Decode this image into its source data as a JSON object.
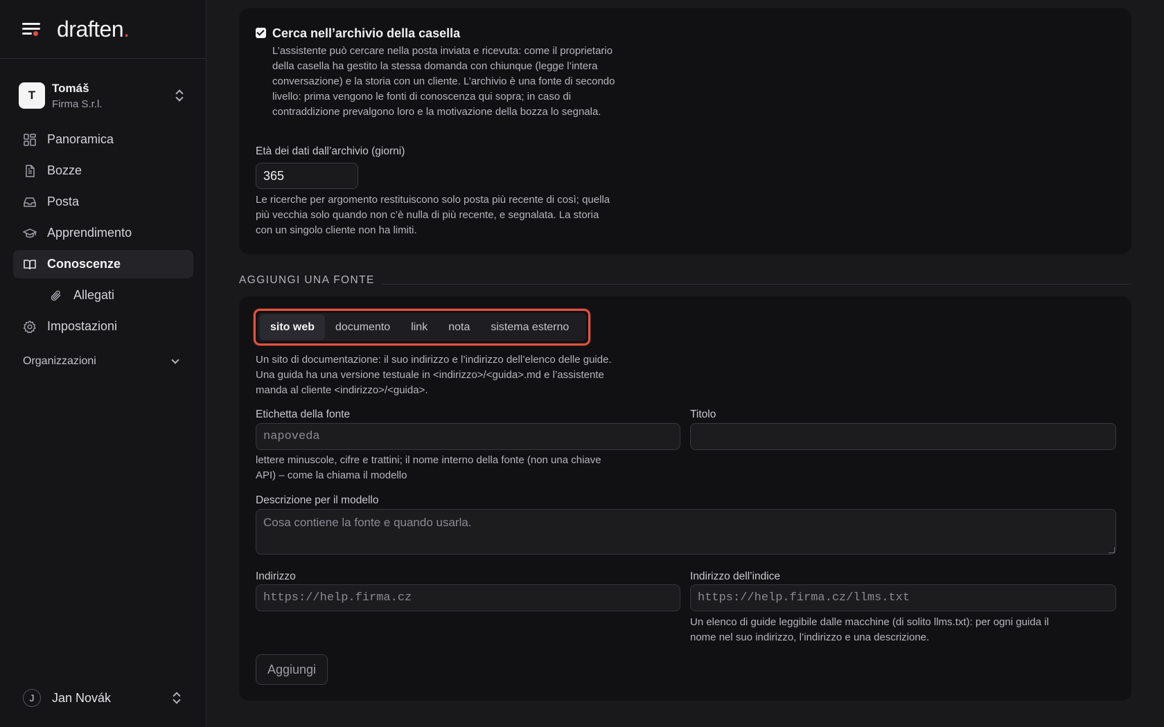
{
  "brand": {
    "logo_text": "draften",
    "logo_dot": "."
  },
  "org": {
    "initial": "T",
    "name": "Tomáš",
    "subtitle": "Firma S.r.l."
  },
  "nav": {
    "items": [
      {
        "label": "Panoramica",
        "icon": "grid-icon"
      },
      {
        "label": "Bozze",
        "icon": "document-icon"
      },
      {
        "label": "Posta",
        "icon": "inbox-icon"
      },
      {
        "label": "Apprendimento",
        "icon": "graduation-cap-icon"
      },
      {
        "label": "Conoscenze",
        "icon": "book-icon",
        "active": true
      },
      {
        "label": "Allegati",
        "icon": "paperclip-icon",
        "sub": true
      },
      {
        "label": "Impostazioni",
        "icon": "gear-icon"
      }
    ],
    "organizations_label": "Organizzazioni"
  },
  "user": {
    "initial": "J",
    "name": "Jan Novák"
  },
  "archive": {
    "checkbox_label": "Cerca nell’archivio della casella",
    "checked": true,
    "description": "L’assistente può cercare nella posta inviata e ricevuta: come il proprietario della casella ha gestito la stessa domanda con chiunque (legge l’intera conversazione) e la storia con un cliente. L’archivio è una fonte di secondo livello: prima vengono le fonti di conoscenza qui sopra; in caso di contraddizione prevalgono loro e la motivazione della bozza lo segnala.",
    "age_label": "Età dei dati dall’archivio (giorni)",
    "age_value": "365",
    "age_help": "Le ricerche per argomento restituiscono solo posta più recente di così; quella più vecchia solo quando non c’è nulla di più recente, e segnalata. La storia con un singolo cliente non ha limiti."
  },
  "add_source": {
    "section_title": "AGGIUNGI UNA FONTE",
    "tabs": [
      "sito web",
      "documento",
      "link",
      "nota",
      "sistema esterno"
    ],
    "active_tab": "sito web",
    "tab_description": "Un sito di documentazione: il suo indirizzo e l’indirizzo dell’elenco delle guide. Una guida ha una versione testuale in <indirizzo>/<guida>.md e l’assistente manda al cliente <indirizzo>/<guida>.",
    "label_field": {
      "label": "Etichetta della fonte",
      "placeholder": "napoveda",
      "value": ""
    },
    "label_help": "lettere minuscole, cifre e trattini; il nome interno della fonte (non una chiave API) – come la chiama il modello",
    "title_field": {
      "label": "Titolo",
      "placeholder": "",
      "value": ""
    },
    "description_field": {
      "label": "Descrizione per il modello",
      "placeholder": "Cosa contiene la fonte e quando usarla.",
      "value": ""
    },
    "address_field": {
      "label": "Indirizzo",
      "placeholder": "https://help.firma.cz",
      "value": ""
    },
    "index_field": {
      "label": "Indirizzo dell’indice",
      "placeholder": "https://help.firma.cz/llms.txt",
      "value": ""
    },
    "index_help": "Un elenco di guide leggibile dalle macchine (di solito llms.txt): per ogni guida il nome nel suo indirizzo, l’indirizzo e una descrizione.",
    "submit_label": "Aggiungi"
  },
  "colors": {
    "accent": "#e5484d",
    "highlight_border": "#e5533f"
  }
}
